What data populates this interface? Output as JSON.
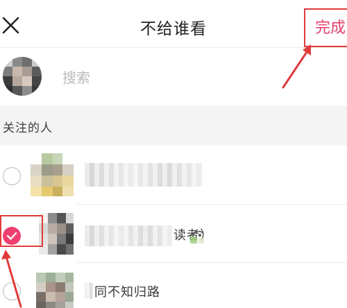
{
  "header": {
    "title": "不给谁看",
    "done_label": "完成",
    "close_icon": "close-icon"
  },
  "search": {
    "placeholder": "搜索"
  },
  "section": {
    "title": "关注的人"
  },
  "contacts": [
    {
      "name": "",
      "selected": false
    },
    {
      "name": "读者）",
      "selected": true
    },
    {
      "name": "同不知归路",
      "selected": false
    }
  ],
  "colors": {
    "accent": "#e4406a",
    "checkbox_fill": "#ee3f70",
    "annotation": "#e23a3a"
  }
}
